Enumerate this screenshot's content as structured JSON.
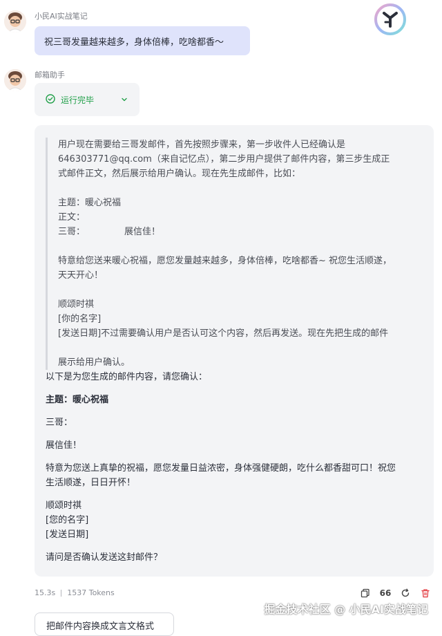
{
  "chat": {
    "user": {
      "name": "小民AI实战笔记",
      "message": "祝三哥发量越来越多，身体倍棒，吃啥都香～"
    },
    "assistant": {
      "name": "邮箱助手",
      "status": "运行完毕",
      "thinking": {
        "line1": "用户现在需要给三哥发邮件，首先按照步骤来，第一步收件人已经确认是",
        "line2": "646303771@qq.com（来自记忆点），第二步用户提供了邮件内容，第三步生成正",
        "line3": "式邮件正文，然后展示给用户确认。现在先生成邮件，比如：",
        "subject": "主题：暖心祝福",
        "body_label": "正文：",
        "greeting_name": "三哥：",
        "greeting_text": "展信佳！",
        "wish_line1": "特意给您送来暖心祝福，愿您发量越来越多，身体倍棒，吃啥都香~ 祝您生活顺遂，",
        "wish_line2": "天天开心！",
        "closing": "顺颂时祺",
        "your_name": "[你的名字]",
        "date_line": "[发送日期]不过需要确认用户是否认可这个内容，然后再发送。现在先把生成的邮件",
        "show_line": "展示给用户确认。"
      },
      "reply": {
        "intro": "以下是为您生成的邮件内容，请您确认：",
        "subject": "主题：暖心祝福",
        "greeting": "三哥：",
        "opening": "展信佳！",
        "body_line1": "特意为您送上真挚的祝福，愿您发量日益浓密，身体强健硬朗，吃什么都香甜可口！祝您",
        "body_line2": "生活顺遂，日日开怀！",
        "closing": "顺颂时祺",
        "your_name": "[您的名字]",
        "date": "[发送日期]",
        "question": "请问是否确认发送这封邮件？"
      },
      "meta": {
        "duration": "15.3s",
        "tokens": "1537 Tokens"
      }
    }
  },
  "actions": {
    "copy_icon": "copy-icon",
    "quote_label": "66",
    "refresh_icon": "refresh-icon",
    "delete_icon": "trash-icon"
  },
  "suggestion": "把邮件内容换成文言文格式",
  "watermark": "掘金技术社区 @ 小民AI实战笔记",
  "colors": {
    "status_green": "#22a04a",
    "user_bubble": "#dfe3fb",
    "answer_bg": "#f3f4f6",
    "delete_red": "#e5484d"
  }
}
